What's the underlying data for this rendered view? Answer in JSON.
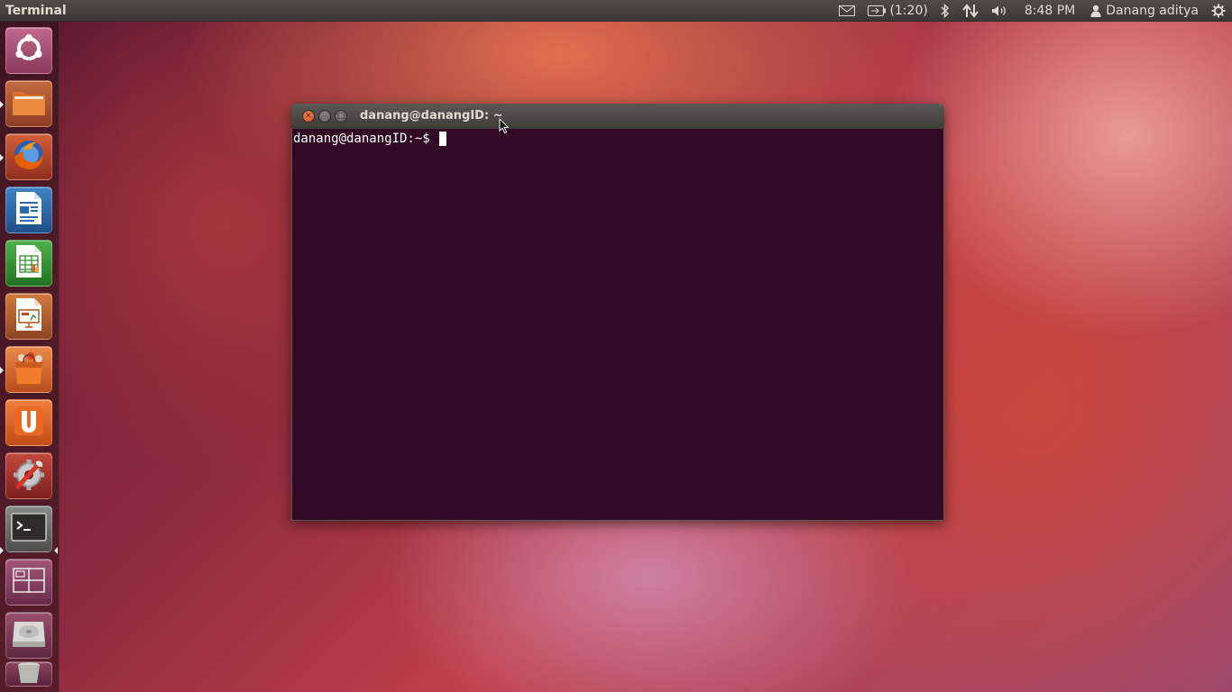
{
  "top_panel": {
    "app_title": "Terminal",
    "battery_time": "(1:20)",
    "clock": "8:48 PM",
    "user_name": "Danang aditya",
    "icons": [
      "mail-icon",
      "battery-icon",
      "bluetooth-icon",
      "network-icon",
      "volume-icon",
      "user-icon",
      "settings-icon"
    ]
  },
  "launcher": {
    "items": [
      {
        "name": "dash-home",
        "icon": "ubuntu-logo-icon"
      },
      {
        "name": "files",
        "icon": "folder-icon"
      },
      {
        "name": "firefox",
        "icon": "firefox-icon"
      },
      {
        "name": "libreoffice-writer",
        "icon": "writer-icon"
      },
      {
        "name": "libreoffice-calc",
        "icon": "calc-icon"
      },
      {
        "name": "libreoffice-impress",
        "icon": "impress-icon"
      },
      {
        "name": "software-center",
        "icon": "software-center-icon"
      },
      {
        "name": "ubuntu-one",
        "icon": "ubuntu-one-icon"
      },
      {
        "name": "system-settings",
        "icon": "settings-tools-icon"
      },
      {
        "name": "terminal",
        "icon": "terminal-icon"
      },
      {
        "name": "workspace-switcher",
        "icon": "workspace-icon"
      },
      {
        "name": "drive",
        "icon": "hard-drive-icon"
      },
      {
        "name": "trash",
        "icon": "trash-icon"
      }
    ],
    "colors": {
      "accent": "#e05a22"
    }
  },
  "window": {
    "title": "danang@danangID: ~",
    "prompt": "danang@danangID:~$ ",
    "colors": {
      "background": "#300a24",
      "text": "#ffffff"
    }
  }
}
